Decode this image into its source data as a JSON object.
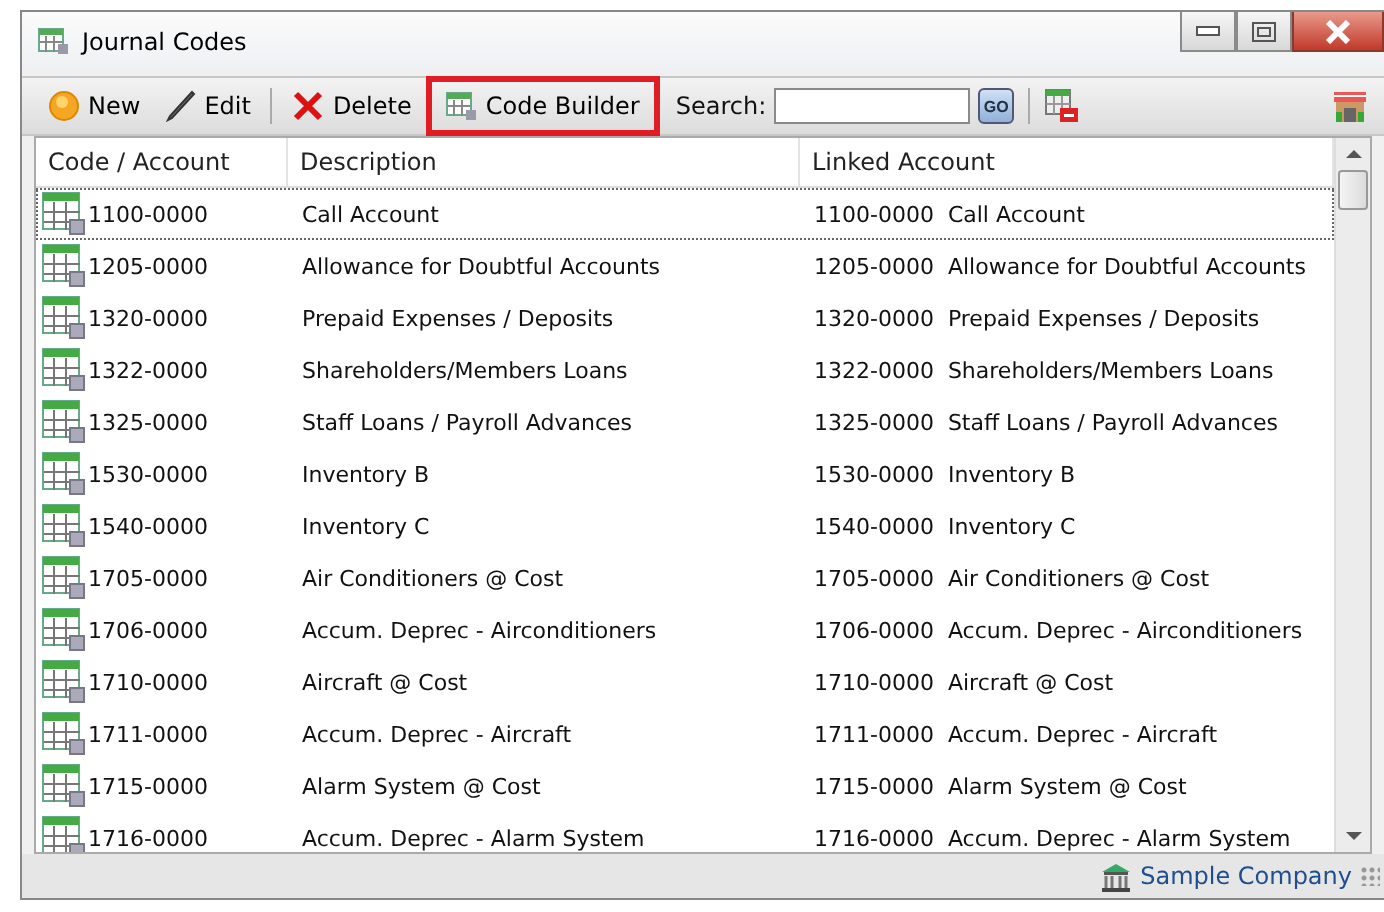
{
  "window": {
    "title": "Journal Codes"
  },
  "toolbar": {
    "buttons": [
      {
        "kind": "new",
        "label": "New",
        "highlighted": false
      },
      {
        "kind": "edit",
        "label": "Edit",
        "highlighted": false
      },
      {
        "kind": "delete",
        "label": "Delete",
        "highlighted": false
      },
      {
        "kind": "builder",
        "label": "Code Builder",
        "highlighted": true
      }
    ],
    "search": {
      "label": "Search:",
      "go": "GO"
    }
  },
  "table": {
    "columns": [
      "Code / Account",
      "Description",
      "Linked Account"
    ],
    "rows": [
      {
        "code": "1100-0000",
        "description": "Call Account",
        "linked": "1100-0000  Call Account",
        "selected": true
      },
      {
        "code": "1205-0000",
        "description": "Allowance for Doubtful Accounts",
        "linked": "1205-0000  Allowance for Doubtful Accounts",
        "selected": false
      },
      {
        "code": "1320-0000",
        "description": "Prepaid Expenses / Deposits",
        "linked": "1320-0000  Prepaid Expenses / Deposits",
        "selected": false
      },
      {
        "code": "1322-0000",
        "description": "Shareholders/Members Loans",
        "linked": "1322-0000  Shareholders/Members Loans",
        "selected": false
      },
      {
        "code": "1325-0000",
        "description": "Staff Loans / Payroll Advances",
        "linked": "1325-0000  Staff Loans / Payroll Advances",
        "selected": false
      },
      {
        "code": "1530-0000",
        "description": "Inventory B",
        "linked": "1530-0000  Inventory B",
        "selected": false
      },
      {
        "code": "1540-0000",
        "description": "Inventory C",
        "linked": "1540-0000  Inventory C",
        "selected": false
      },
      {
        "code": "1705-0000",
        "description": "Air Conditioners @ Cost",
        "linked": "1705-0000  Air Conditioners @ Cost",
        "selected": false
      },
      {
        "code": "1706-0000",
        "description": "Accum. Deprec - Airconditioners",
        "linked": "1706-0000  Accum. Deprec - Airconditioners",
        "selected": false
      },
      {
        "code": "1710-0000",
        "description": "Aircraft @ Cost",
        "linked": "1710-0000  Aircraft @ Cost",
        "selected": false
      },
      {
        "code": "1711-0000",
        "description": "Accum. Deprec - Aircraft",
        "linked": "1711-0000  Accum. Deprec - Aircraft",
        "selected": false
      },
      {
        "code": "1715-0000",
        "description": "Alarm System @ Cost",
        "linked": "1715-0000  Alarm System @ Cost",
        "selected": false
      },
      {
        "code": "1716-0000",
        "description": "Accum. Deprec - Alarm System",
        "linked": "1716-0000  Accum. Deprec - Alarm System",
        "selected": false
      }
    ]
  },
  "status_bar": {
    "company": "Sample Company"
  }
}
